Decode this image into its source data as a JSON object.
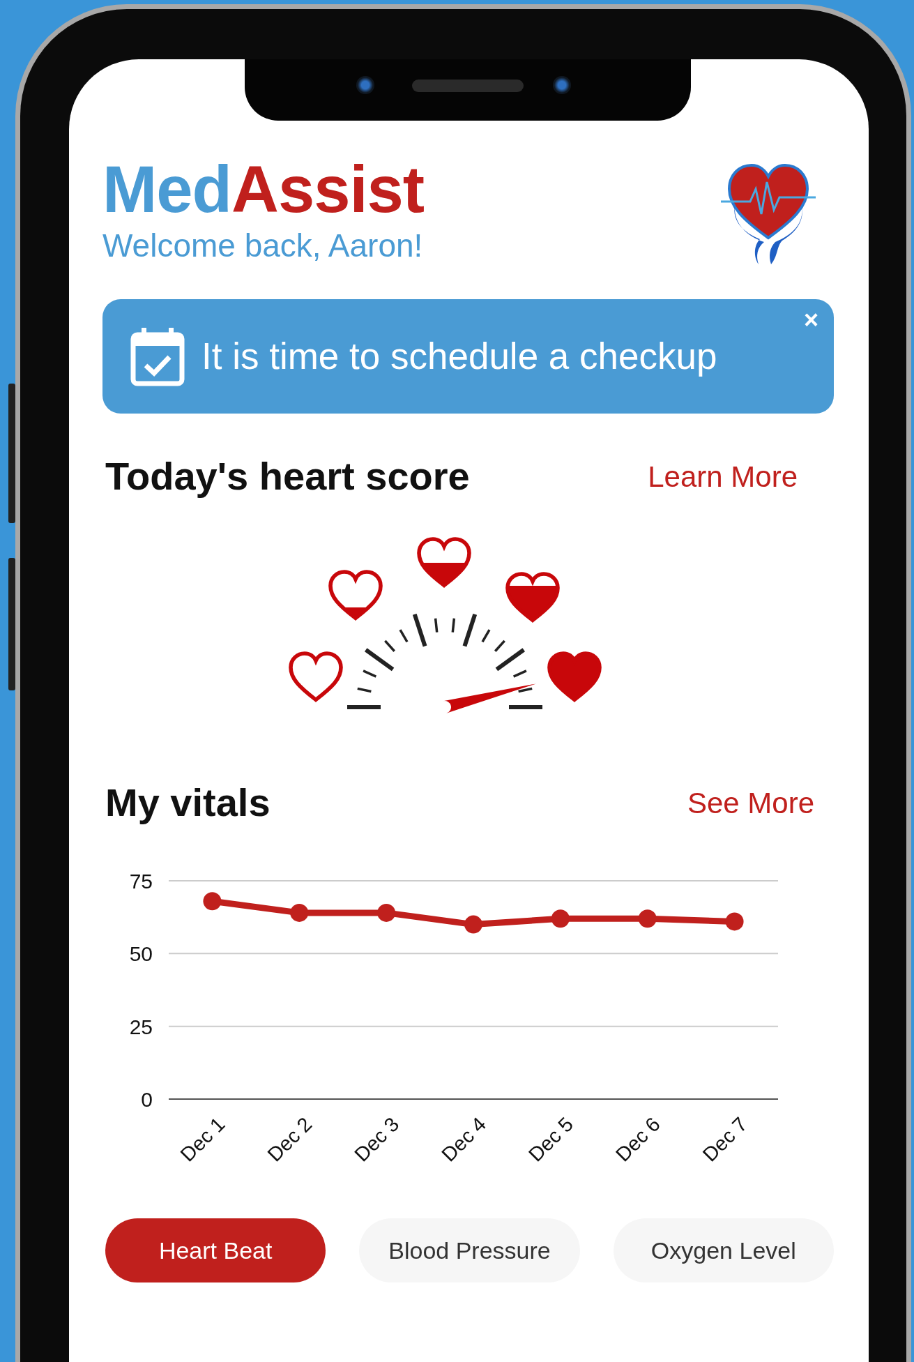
{
  "header": {
    "brand": [
      {
        "text": "Med",
        "color": "#4a9bd4"
      },
      {
        "text": "Assist",
        "color": "#c0201d"
      }
    ],
    "greeting": "Welcome back, Aaron!"
  },
  "notification": {
    "text": "It is time to schedule a checkup",
    "close": "×"
  },
  "heart_score": {
    "title": "Today's heart score",
    "link": "Learn More"
  },
  "vitals": {
    "title": "My vitals",
    "link": "See More",
    "chart_data": {
      "type": "line",
      "categories": [
        "Dec 1",
        "Dec 2",
        "Dec 3",
        "Dec 4",
        "Dec 5",
        "Dec 6",
        "Dec 7"
      ],
      "ylim": [
        0,
        75
      ],
      "yticks": [
        0,
        25,
        50,
        75
      ],
      "series": [
        {
          "color": "#c0201d",
          "marker": "circle",
          "values": [
            68,
            64,
            64,
            60,
            62,
            62,
            61
          ]
        }
      ]
    },
    "tabs": [
      {
        "label": "Heart Beat",
        "selected": true
      },
      {
        "label": "Blood Pressure",
        "selected": false
      },
      {
        "label": "Oxygen Level",
        "selected": false
      }
    ]
  }
}
